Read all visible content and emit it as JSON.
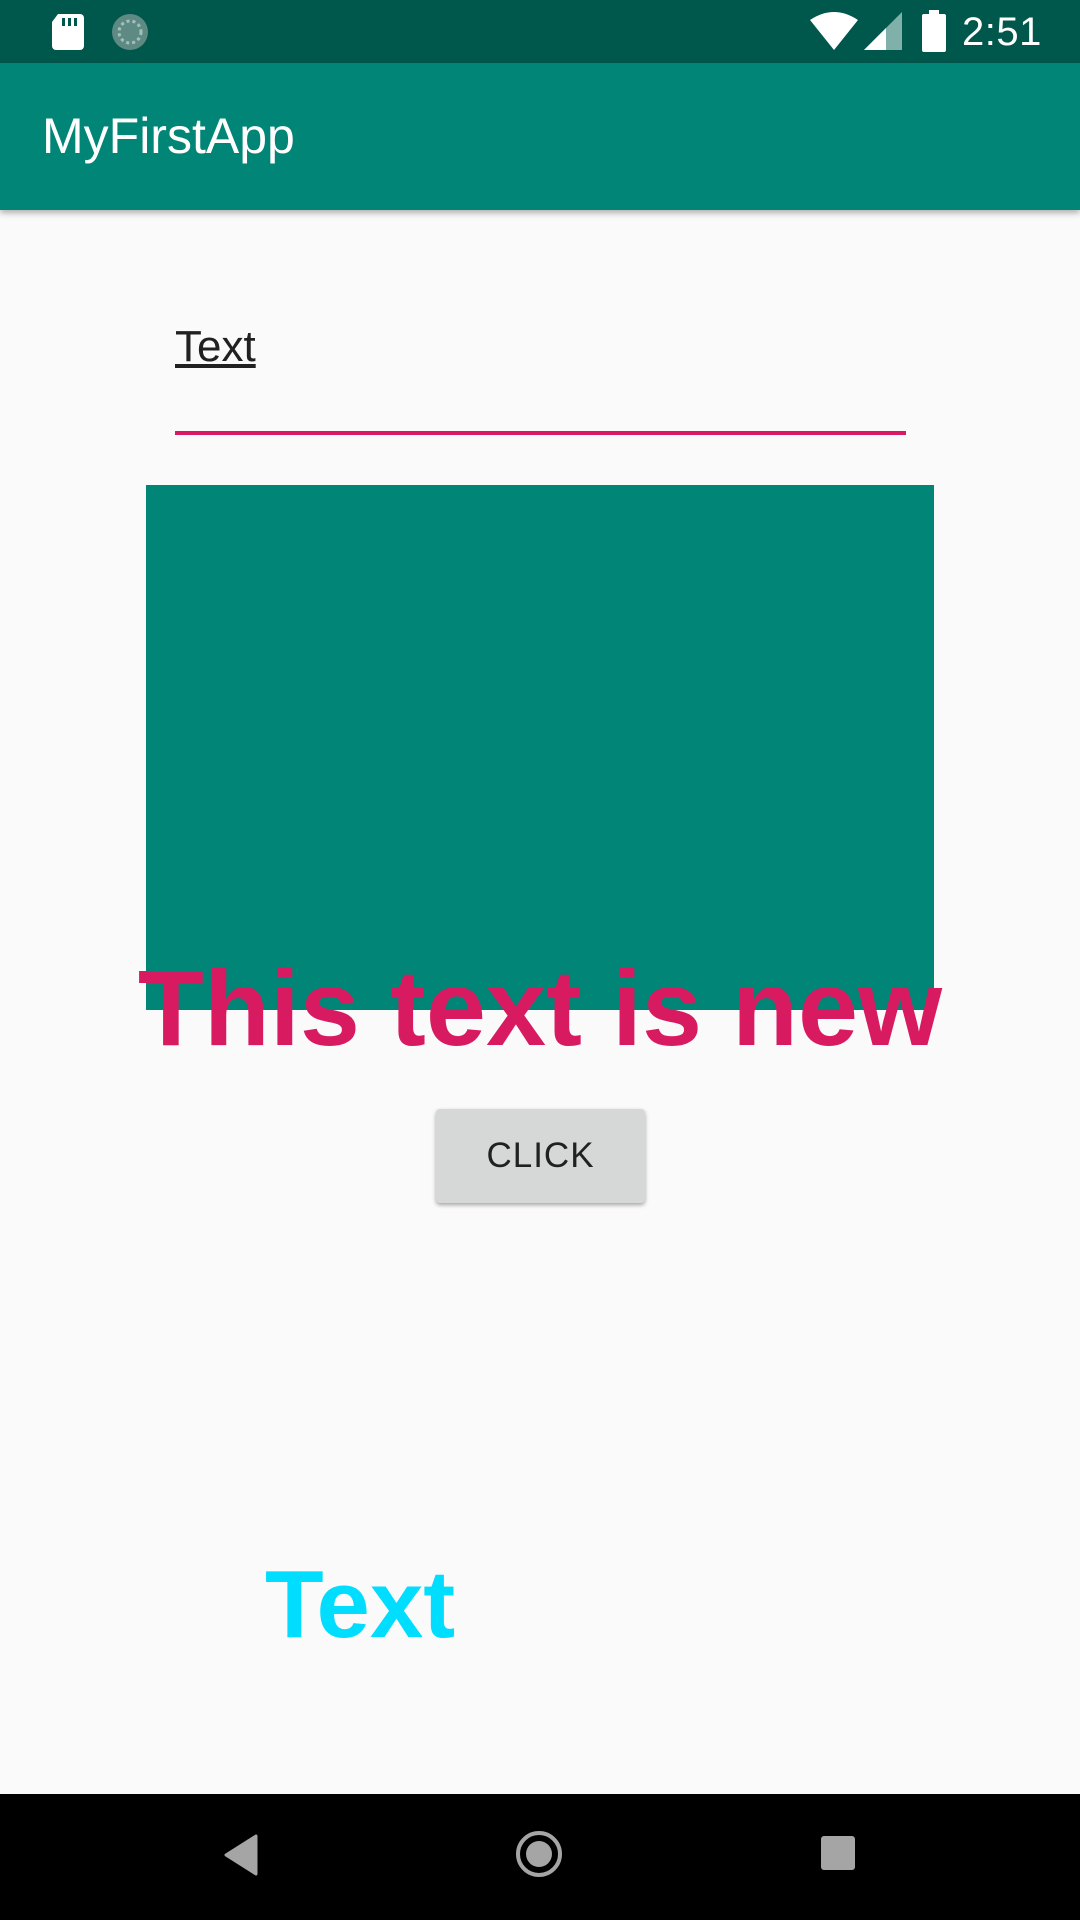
{
  "status_bar": {
    "time": "2:51",
    "icons": [
      "sd-card-icon",
      "sync-icon",
      "wifi-icon",
      "signal-icon",
      "battery-icon"
    ]
  },
  "app_bar": {
    "title": "MyFirstApp"
  },
  "edit_text": {
    "value": "Text"
  },
  "headline": {
    "text": "This text is new"
  },
  "button": {
    "label": "CLICK"
  },
  "bottom_text": {
    "text": "Text"
  },
  "nav_bar": {
    "icons": [
      "back-icon",
      "home-icon",
      "recents-icon"
    ]
  },
  "colors": {
    "status_bar": "#00574b",
    "primary": "#008577",
    "accent": "#d81b60",
    "bottom_text": "#00ddff",
    "button_bg": "#d6d7d7",
    "background": "#fafafa"
  }
}
